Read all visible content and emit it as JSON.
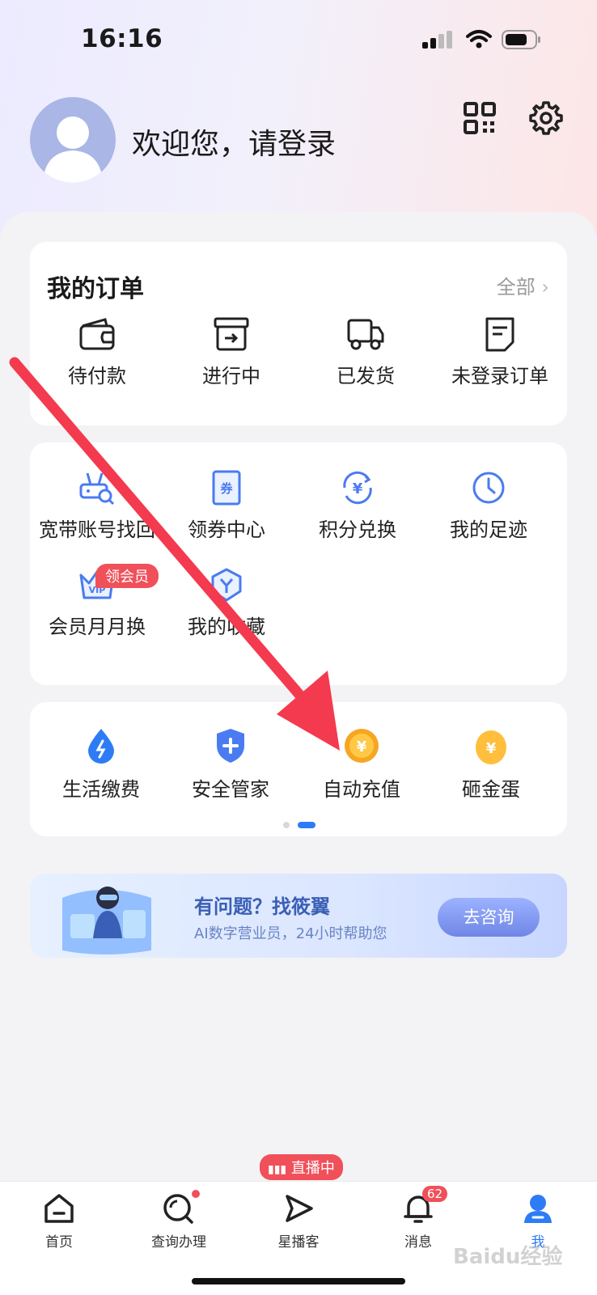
{
  "status_bar": {
    "time": "16:16"
  },
  "header": {
    "welcome": "欢迎您，请登录"
  },
  "orders": {
    "title": "我的订单",
    "all_label": "全部",
    "items": [
      {
        "label": "待付款",
        "icon": "wallet-icon"
      },
      {
        "label": "进行中",
        "icon": "box-arrow-icon"
      },
      {
        "label": "已发货",
        "icon": "truck-icon"
      },
      {
        "label": "未登录订单",
        "icon": "note-icon"
      }
    ]
  },
  "services": {
    "items": [
      {
        "label": "宽带账号找回",
        "icon": "router-search-icon"
      },
      {
        "label": "领券中心",
        "icon": "coupon-icon"
      },
      {
        "label": "积分兑换",
        "icon": "yuan-exchange-icon"
      },
      {
        "label": "我的足迹",
        "icon": "clock-icon"
      },
      {
        "label": "会员月月换",
        "icon": "vip-icon"
      },
      {
        "label": "我的收藏",
        "icon": "favorite-icon"
      }
    ],
    "vip_badge": "领会员"
  },
  "tools": {
    "items": [
      {
        "label": "生活缴费",
        "icon": "water-drop-icon"
      },
      {
        "label": "安全管家",
        "icon": "shield-icon"
      },
      {
        "label": "自动充值",
        "icon": "gold-coin-icon"
      },
      {
        "label": "砸金蛋",
        "icon": "golden-egg-icon"
      }
    ],
    "pagination": {
      "pages": 2,
      "active": 2
    }
  },
  "banner": {
    "title": "有问题？找筱翼",
    "subtitle": "AI数字营业员，24小时帮助您",
    "button": "去咨询"
  },
  "bottom_nav": {
    "items": [
      {
        "label": "首页",
        "icon": "home-icon"
      },
      {
        "label": "查询办理",
        "icon": "search-query-icon"
      },
      {
        "label": "星播客",
        "icon": "play-icon"
      },
      {
        "label": "消息",
        "icon": "bell-icon"
      },
      {
        "label": "我",
        "icon": "user-icon"
      }
    ],
    "live_badge": "直播中",
    "message_count": "62"
  },
  "watermark": "Baidu经验",
  "colors": {
    "accent": "#2d7cf6",
    "badge": "#f0505a",
    "arrow": "#f43a4e"
  }
}
